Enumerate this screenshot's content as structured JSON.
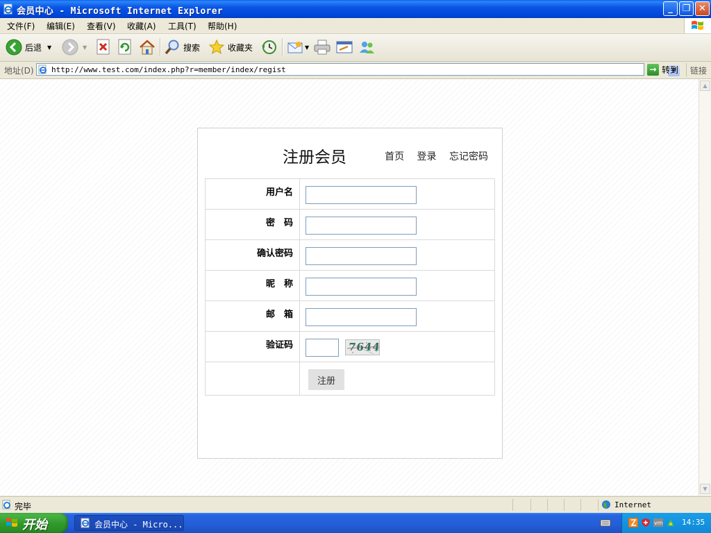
{
  "window": {
    "title": "会员中心 - Microsoft Internet Explorer",
    "min_glyph": "_",
    "max_glyph": "❐",
    "close_glyph": "✕"
  },
  "menu": {
    "items": [
      "文件(F)",
      "编辑(E)",
      "查看(V)",
      "收藏(A)",
      "工具(T)",
      "帮助(H)"
    ]
  },
  "toolbar": {
    "back_label": "后退",
    "search_label": "搜索",
    "favorites_label": "收藏夹"
  },
  "address": {
    "label": "地址(D)",
    "url": "http://www.test.com/index.php?r=member/index/regist",
    "go_label": "转到",
    "links_label": "链接"
  },
  "page": {
    "title": "注册会员",
    "nav": [
      "首页",
      "登录",
      "忘记密码"
    ],
    "form": {
      "username_label": "用户名",
      "password_label": "密　码",
      "confirm_label": "确认密码",
      "nickname_label": "昵　称",
      "email_label": "邮　箱",
      "captcha_label": "验证码",
      "captcha_code": "7644",
      "submit_label": "注册"
    }
  },
  "status": {
    "text": "完毕",
    "zone": "Internet"
  },
  "taskbar": {
    "start_label": "开始",
    "task_label": "会员中心 - Micro...",
    "clock": "14:35"
  },
  "colors": {
    "title_bar": "#0a55e6",
    "start_button": "#2f9a2c",
    "input_border": "#7f9db9"
  }
}
